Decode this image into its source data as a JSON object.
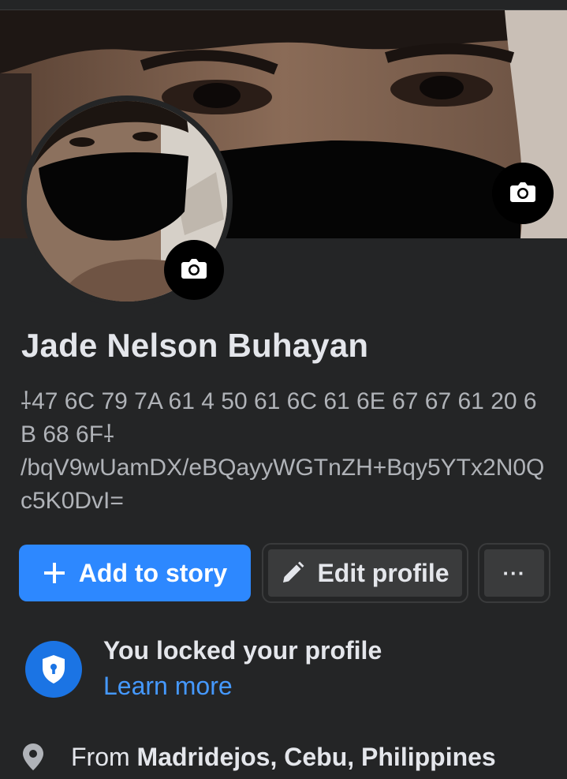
{
  "profile": {
    "name": "Jade Nelson Buhayan",
    "bio": "⸸47 6C 79 7A 61 4 50 61 6C 61 6E 67 67 61 20 6B 68 6F⸸\n/bqV9wUamDX/eBQayyWGTnZH+Bqy5YTx2N0Qc5K0DvI="
  },
  "actions": {
    "add_story_label": "Add to story",
    "edit_profile_label": "Edit profile",
    "more_label": "···"
  },
  "privacy": {
    "locked_title": "You locked your profile",
    "learn_more_label": "Learn more"
  },
  "details": {
    "from_prefix": "From",
    "hometown": "Madridejos, Cebu, Philippines"
  },
  "icons": {
    "cover_camera": "camera-icon",
    "avatar_camera": "camera-icon",
    "add": "plus-icon",
    "edit": "pencil-icon",
    "more": "more-icon",
    "lock": "shield-lock-icon",
    "location": "map-pin-icon"
  },
  "colors": {
    "background": "#242526",
    "primary_button": "#2d88ff",
    "secondary_button": "#3a3b3c",
    "link": "#4599ff",
    "shield_badge": "#1b74e4"
  }
}
